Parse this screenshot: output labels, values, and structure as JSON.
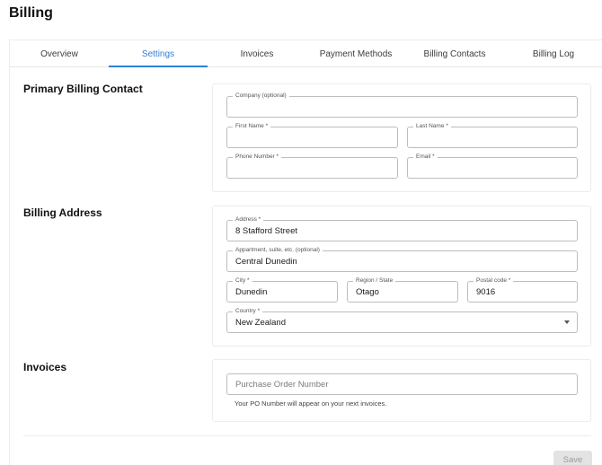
{
  "page": {
    "title": "Billing"
  },
  "tabs": [
    {
      "label": "Overview"
    },
    {
      "label": "Settings"
    },
    {
      "label": "Invoices"
    },
    {
      "label": "Payment Methods"
    },
    {
      "label": "Billing Contacts"
    },
    {
      "label": "Billing Log"
    }
  ],
  "active_tab": "Settings",
  "contact": {
    "title": "Primary Billing Contact",
    "company": {
      "label": "Company (optional)",
      "value": ""
    },
    "first_name": {
      "label": "First Name *",
      "value": ""
    },
    "last_name": {
      "label": "Last Name *",
      "value": ""
    },
    "phone": {
      "label": "Phone Number *",
      "value": ""
    },
    "email": {
      "label": "Email *",
      "value": ""
    }
  },
  "address": {
    "title": "Billing Address",
    "address": {
      "label": "Address *",
      "value": "8 Stafford Street"
    },
    "apartment": {
      "label": "Appartment, suite, etc. (optional)",
      "value": "Central Dunedin"
    },
    "city": {
      "label": "City *",
      "value": "Dunedin"
    },
    "region": {
      "label": "Region / State",
      "value": "Otago"
    },
    "postal": {
      "label": "Postal code *",
      "value": "9016"
    },
    "country": {
      "label": "Country *",
      "value": "New Zealand"
    }
  },
  "invoices": {
    "title": "Invoices",
    "po_placeholder": "Purchase Order Number",
    "helper": "Your PO Number will appear on your next invoices."
  },
  "actions": {
    "save_label": "Save"
  }
}
